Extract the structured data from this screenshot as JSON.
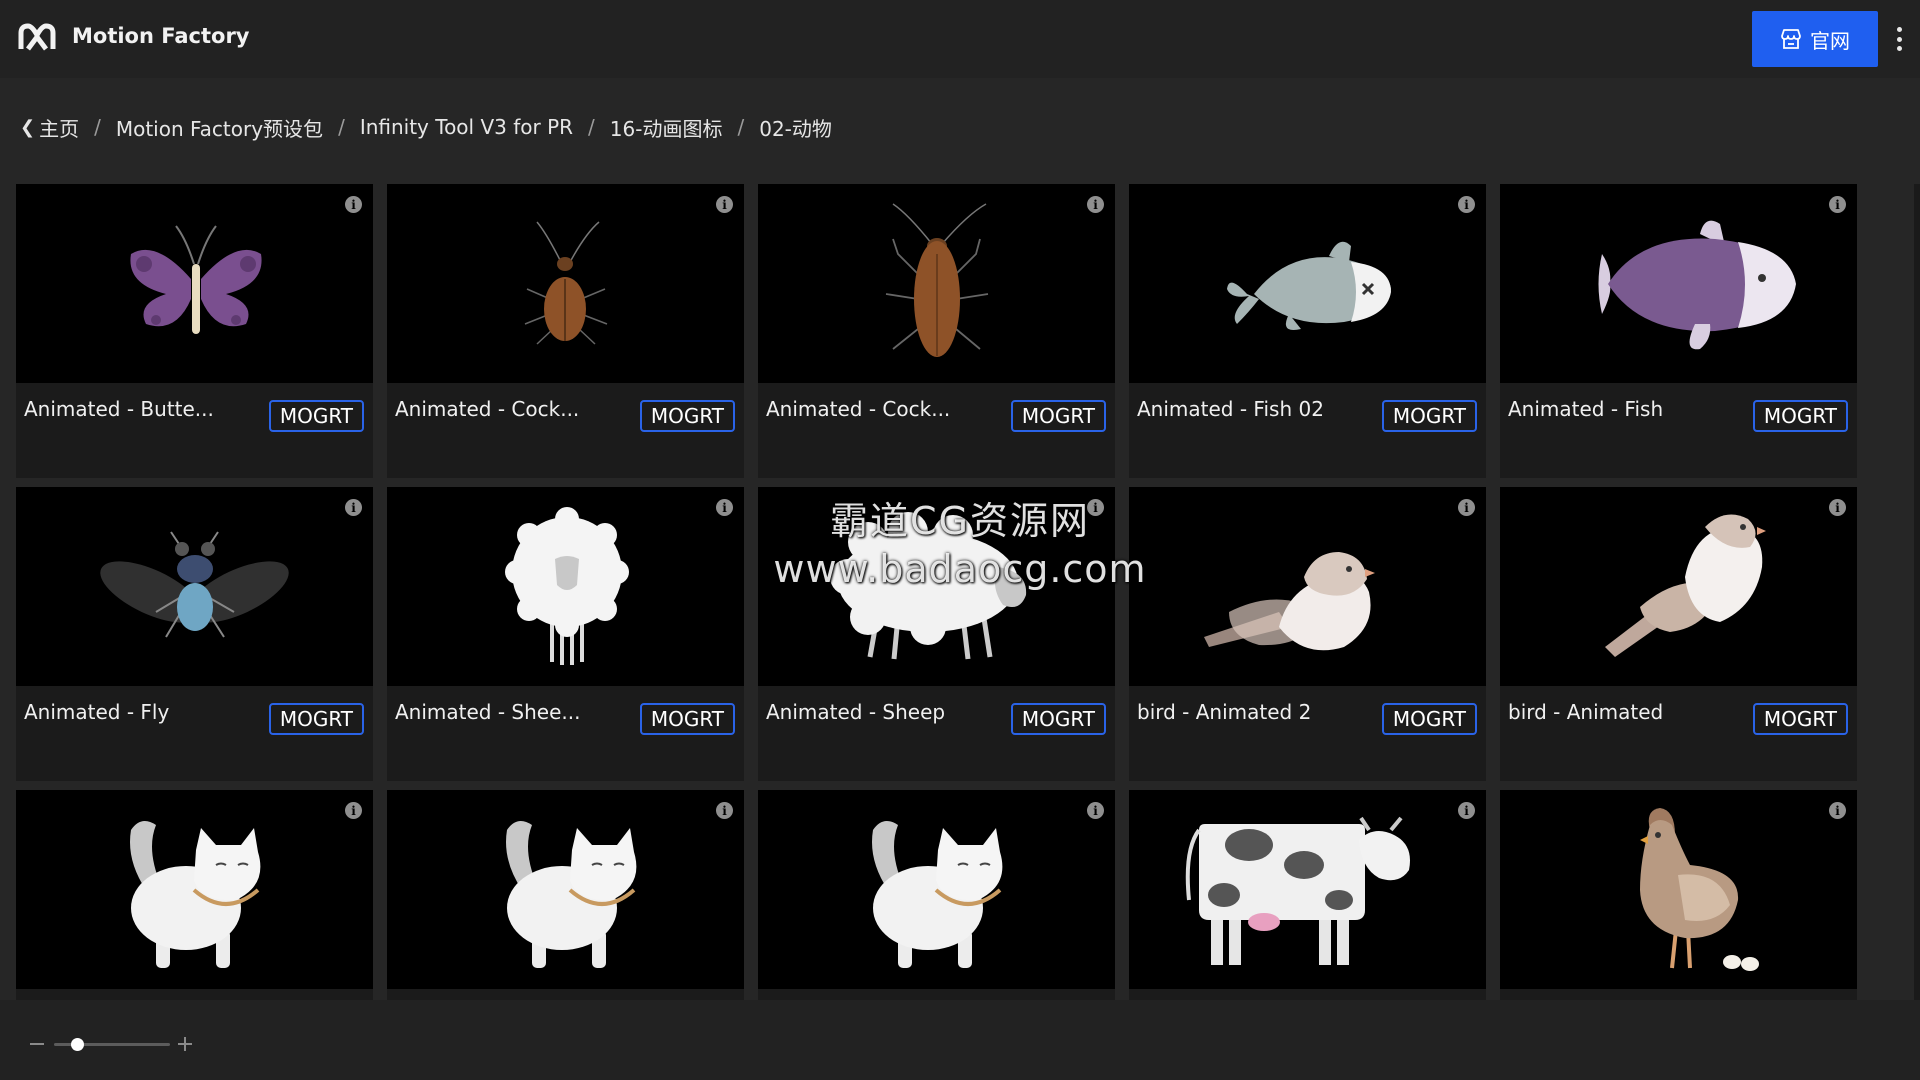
{
  "app": {
    "title": "Motion Factory",
    "site_button_label": "官网"
  },
  "breadcrumb": [
    "主页",
    "Motion Factory预设包",
    "Infinity Tool V3 for PR",
    "16-动画图标",
    "02-动物"
  ],
  "breadcrumb_separator": "/",
  "badge_label": "MOGRT",
  "info_glyph": "i",
  "cards": [
    {
      "title": "Animated - Butte...",
      "icon": "butterfly-icon"
    },
    {
      "title": "Animated - Cock...",
      "icon": "cockroach-icon"
    },
    {
      "title": "Animated - Cock...",
      "icon": "cockroach-icon"
    },
    {
      "title": "Animated - Fish 02",
      "icon": "fish-icon"
    },
    {
      "title": "Animated - Fish",
      "icon": "fish-icon"
    },
    {
      "title": "Animated - Fly",
      "icon": "fly-icon"
    },
    {
      "title": "Animated - Shee...",
      "icon": "sheep-icon"
    },
    {
      "title": "Animated - Sheep",
      "icon": "sheep-icon"
    },
    {
      "title": "bird - Animated 2",
      "icon": "bird-icon"
    },
    {
      "title": "bird - Animated",
      "icon": "bird-icon"
    },
    {
      "title": "",
      "icon": "cat-icon"
    },
    {
      "title": "",
      "icon": "cat-icon"
    },
    {
      "title": "",
      "icon": "cat-icon"
    },
    {
      "title": "",
      "icon": "cow-icon"
    },
    {
      "title": "",
      "icon": "hen-icon"
    }
  ],
  "watermark": {
    "line1": "霸道CG资源网",
    "line2": "www.badaocg.com"
  },
  "zoom": {
    "level": 0.2
  },
  "colors": {
    "accent": "#1f5ff0",
    "badge_border": "#2a63e8"
  }
}
